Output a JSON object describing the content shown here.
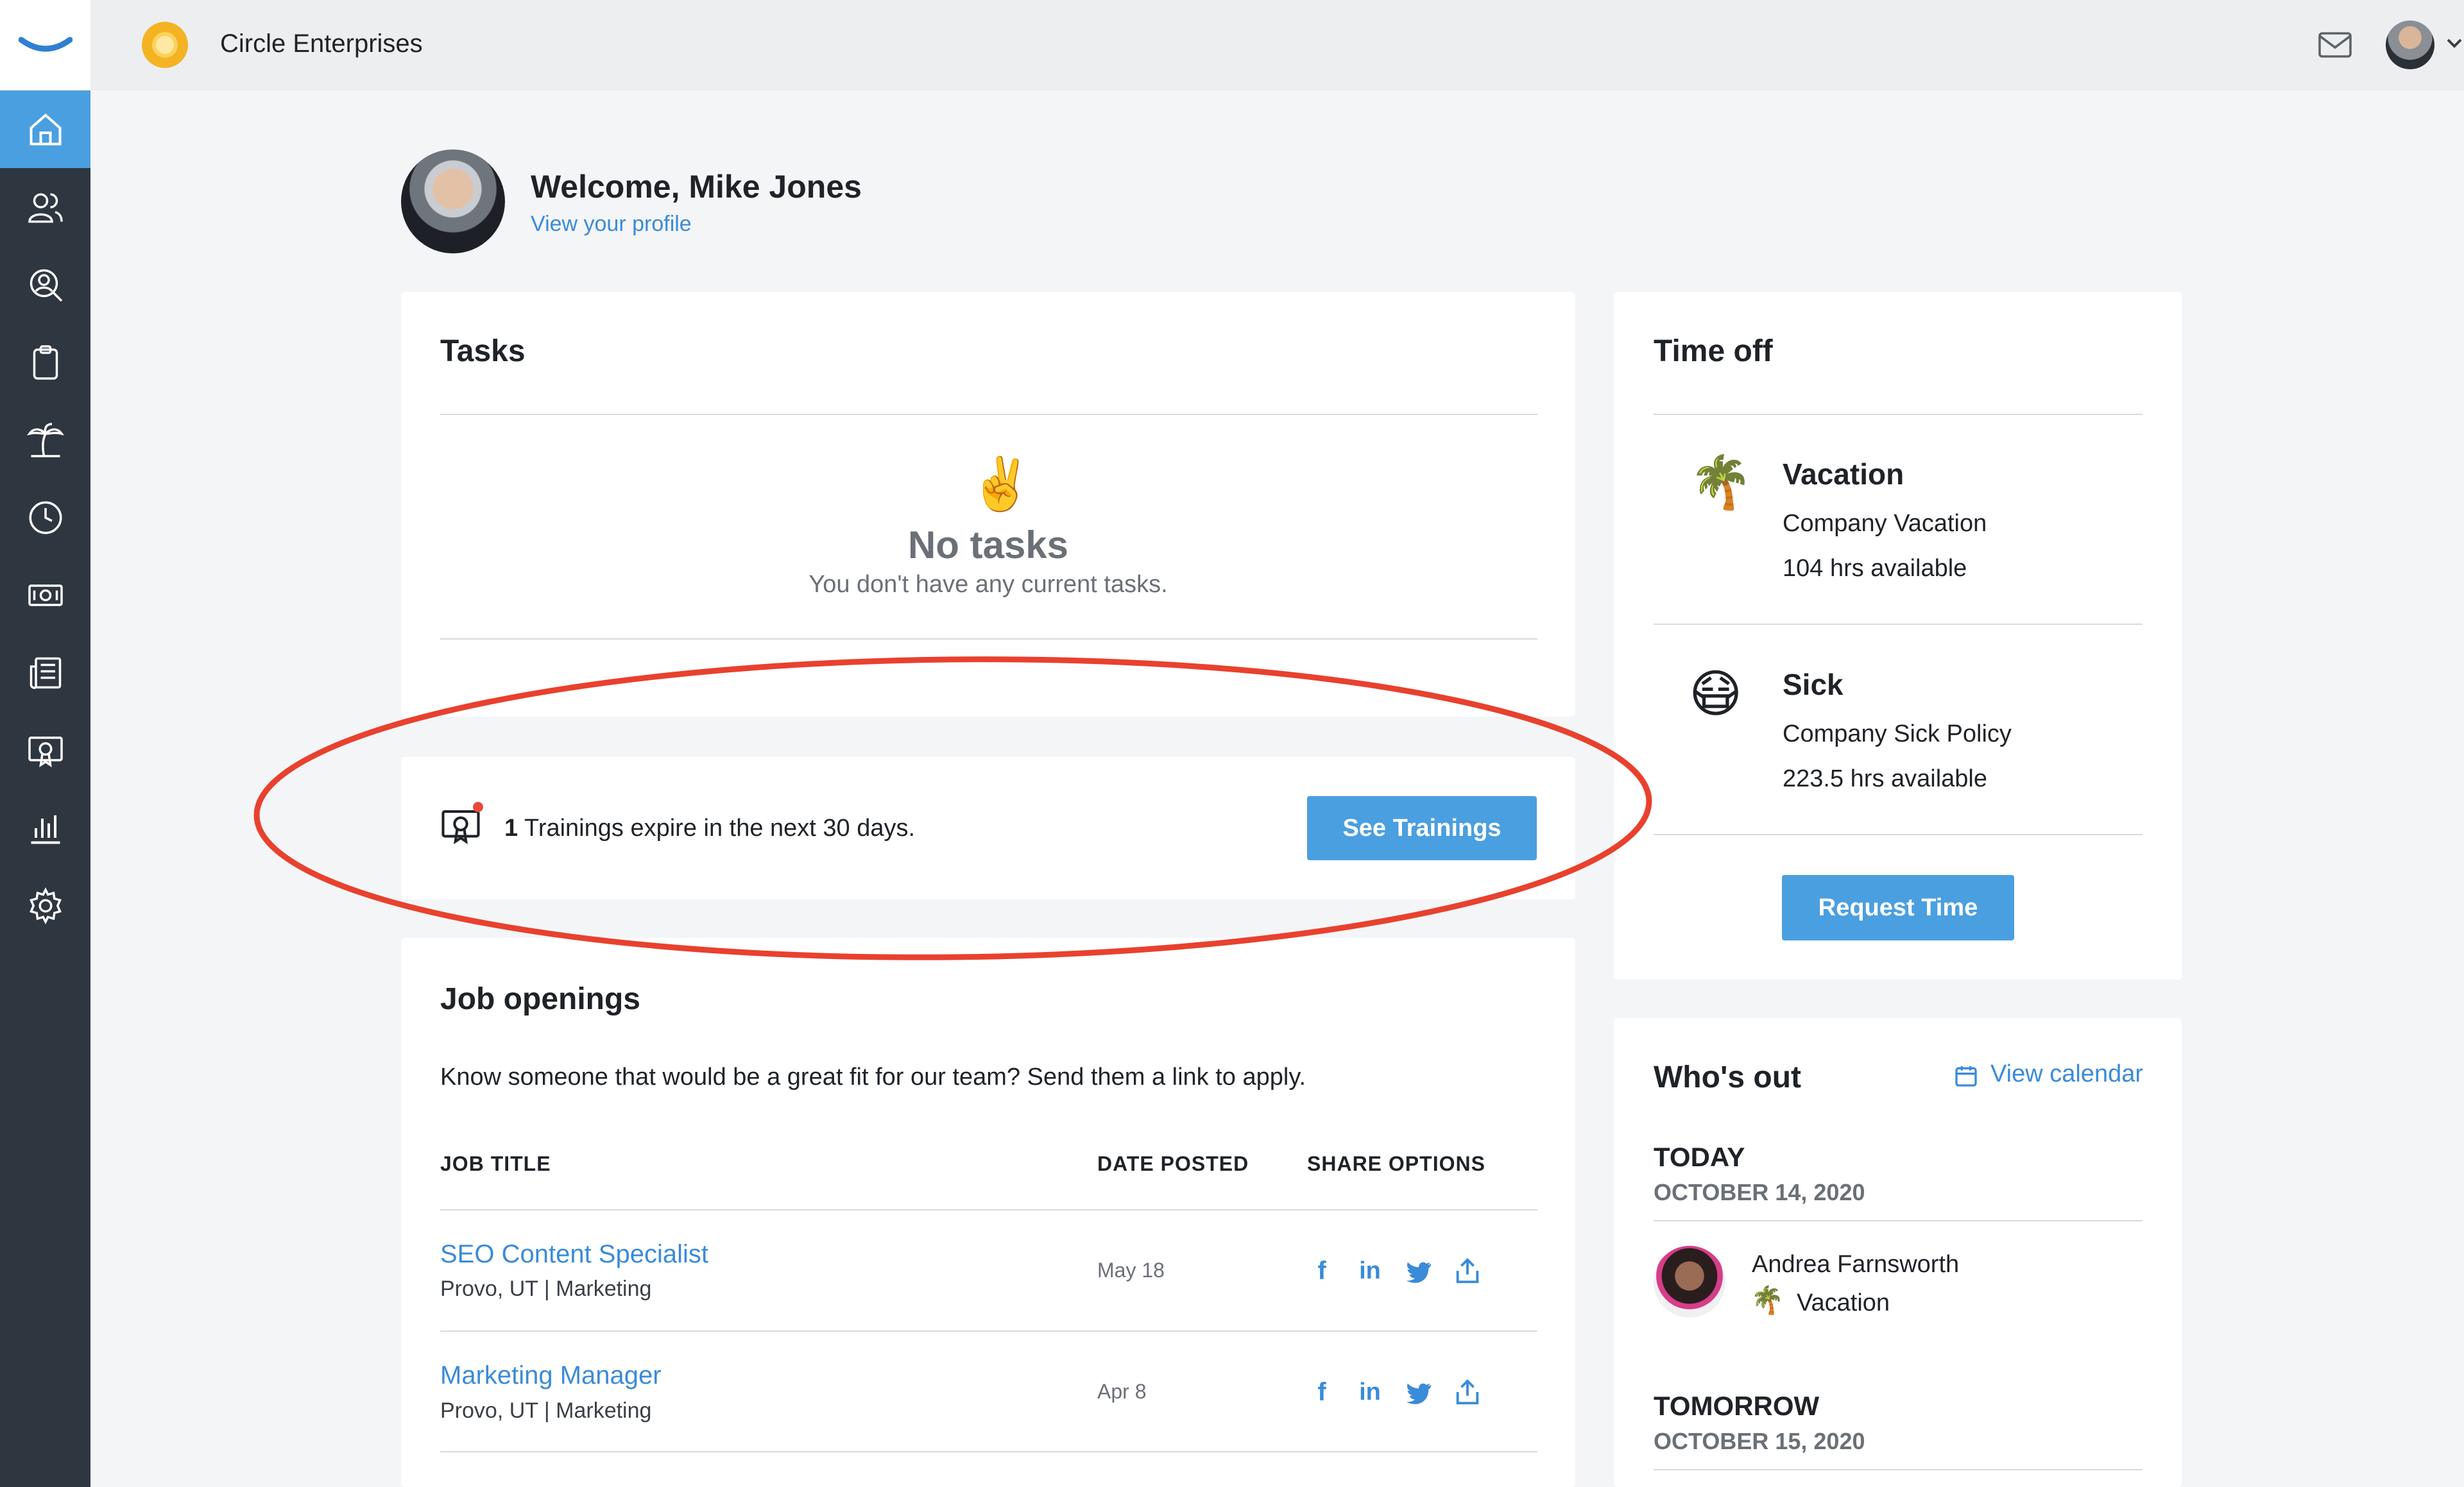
{
  "topbar": {
    "company_name": "Circle Enterprises"
  },
  "sidebar": {
    "items": [
      {
        "icon": "home-icon",
        "active": true
      },
      {
        "icon": "people-icon"
      },
      {
        "icon": "person-search-icon"
      },
      {
        "icon": "clipboard-icon"
      },
      {
        "icon": "palm-tree-icon"
      },
      {
        "icon": "clock-icon"
      },
      {
        "icon": "money-icon"
      },
      {
        "icon": "news-icon"
      },
      {
        "icon": "certificate-icon"
      },
      {
        "icon": "bar-chart-icon"
      },
      {
        "icon": "gear-icon"
      }
    ]
  },
  "welcome": {
    "title": "Welcome, Mike Jones",
    "link": "View your profile"
  },
  "tasks": {
    "title": "Tasks",
    "emoji": "✌️",
    "empty_title": "No tasks",
    "empty_sub": "You don't have any current tasks."
  },
  "trainings": {
    "count": "1",
    "text": "Trainings expire in the next 30 days.",
    "button": "See Trainings"
  },
  "jobs": {
    "title": "Job openings",
    "intro": "Know someone that would be a great fit for our team? Send them a link to apply.",
    "headers": {
      "title": "JOB TITLE",
      "date": "DATE POSTED",
      "share": "SHARE OPTIONS"
    },
    "rows": [
      {
        "title": "SEO Content Specialist",
        "meta": "Provo, UT | Marketing",
        "date": "May 18"
      },
      {
        "title": "Marketing Manager",
        "meta": "Provo, UT | Marketing",
        "date": "Apr 8"
      }
    ]
  },
  "timeoff": {
    "title": "Time off",
    "items": [
      {
        "emoji": "🌴",
        "name": "Vacation",
        "policy": "Company Vacation",
        "available": "104 hrs available"
      },
      {
        "emoji": "😷",
        "name": "Sick",
        "policy": "Company Sick Policy",
        "available": "223.5 hrs available"
      }
    ],
    "button": "Request Time"
  },
  "whosout": {
    "title": "Who's out",
    "calendar_link": "View calendar",
    "today_label": "TODAY",
    "today_date": "OCTOBER 14, 2020",
    "entry": {
      "name": "Andrea Farnsworth",
      "type": "Vacation",
      "emoji": "🌴"
    },
    "tomorrow_label": "TOMORROW",
    "tomorrow_date": "OCTOBER 15, 2020"
  },
  "colors": {
    "accent": "#4a9fe0",
    "link": "#3a8bd8",
    "sidebar": "#2e3640",
    "highlight": "#e8412e"
  }
}
